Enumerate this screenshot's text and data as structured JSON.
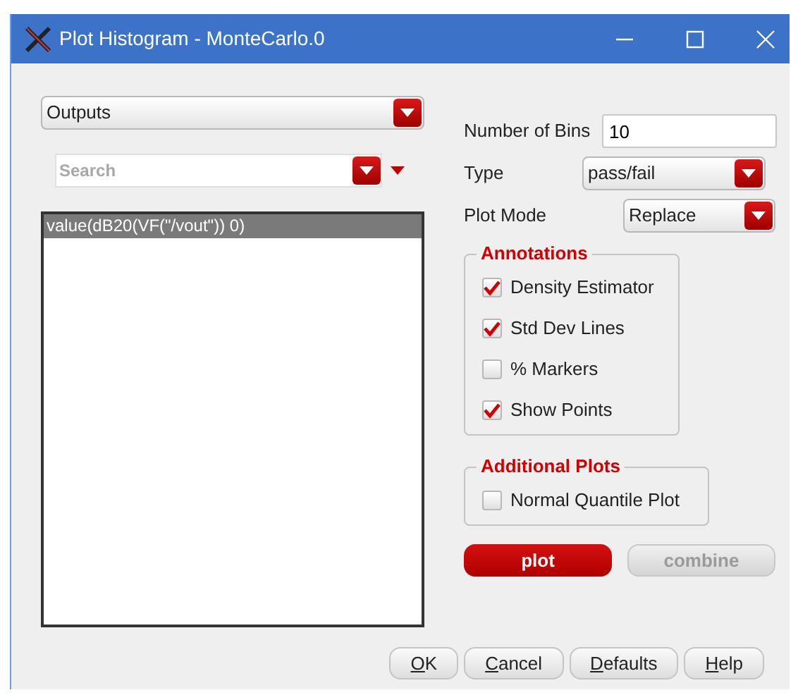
{
  "window": {
    "title": "Plot Histogram - MonteCarlo.0"
  },
  "source_select": {
    "value": "Outputs"
  },
  "search": {
    "placeholder": "Search"
  },
  "outputs_list": [
    {
      "label": "value(dB20(VF(\"/vout\")) 0)",
      "selected": true
    }
  ],
  "number_of_bins": {
    "label": "Number of Bins",
    "value": "10"
  },
  "type": {
    "label": "Type",
    "value": "pass/fail"
  },
  "plot_mode": {
    "label": "Plot Mode",
    "value": "Replace"
  },
  "annotations": {
    "title": "Annotations",
    "items": [
      {
        "label": "Density Estimator",
        "checked": true
      },
      {
        "label": "Std Dev Lines",
        "checked": true
      },
      {
        "label": "% Markers",
        "checked": false
      },
      {
        "label": "Show Points",
        "checked": true
      }
    ]
  },
  "additional_plots": {
    "title": "Additional Plots",
    "items": [
      {
        "label": "Normal Quantile Plot",
        "checked": false
      }
    ]
  },
  "action_buttons": [
    {
      "label": "plot",
      "disabled": false
    },
    {
      "label": "combine",
      "disabled": true
    }
  ],
  "buttons": [
    {
      "label": "OK",
      "access_key": true
    },
    {
      "label": "Cancel",
      "access_key": true
    },
    {
      "label": "Defaults",
      "access_key": true
    },
    {
      "label": "Help",
      "access_key": true
    }
  ]
}
